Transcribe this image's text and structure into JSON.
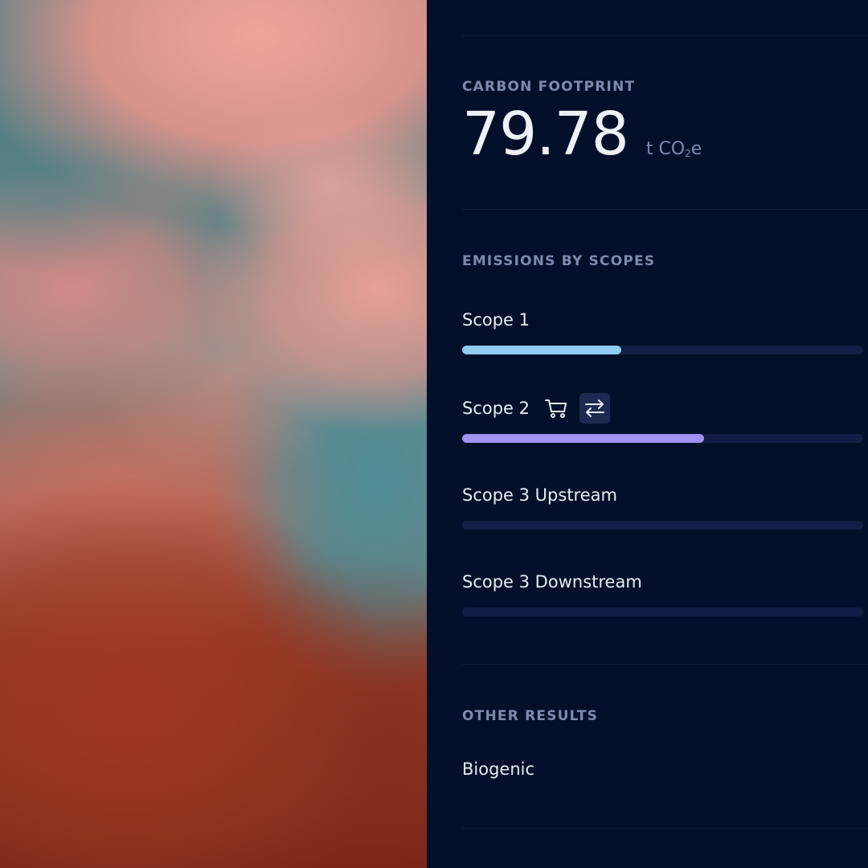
{
  "footprint": {
    "heading": "CARBON FOOTPRINT",
    "value": "79.78",
    "unit_prefix": "t CO",
    "unit_subscript": "2",
    "unit_suffix": "e"
  },
  "scopes": {
    "heading": "EMISSIONS BY SCOPES",
    "items": [
      {
        "label": "Scope 1",
        "fill_fraction": 0.397,
        "fill_color": "#8ecdf0"
      },
      {
        "label": "Scope 2",
        "fill_fraction": 0.603,
        "fill_color": "#9f93f2",
        "icons": [
          "cart-icon",
          "swap-arrows-icon"
        ]
      },
      {
        "label": "Scope 3 Upstream",
        "fill_fraction": 0,
        "fill_color": "#9f93f2"
      },
      {
        "label": "Scope 3 Downstream",
        "fill_fraction": 0,
        "fill_color": "#9f93f2"
      }
    ]
  },
  "other": {
    "heading": "OTHER RESULTS",
    "items": [
      "Biogenic"
    ]
  },
  "colors": {
    "panel_background": "#04102a",
    "track": "#131d45",
    "heading_text": "#7c8bae",
    "primary_text": "#e7ecf5"
  }
}
